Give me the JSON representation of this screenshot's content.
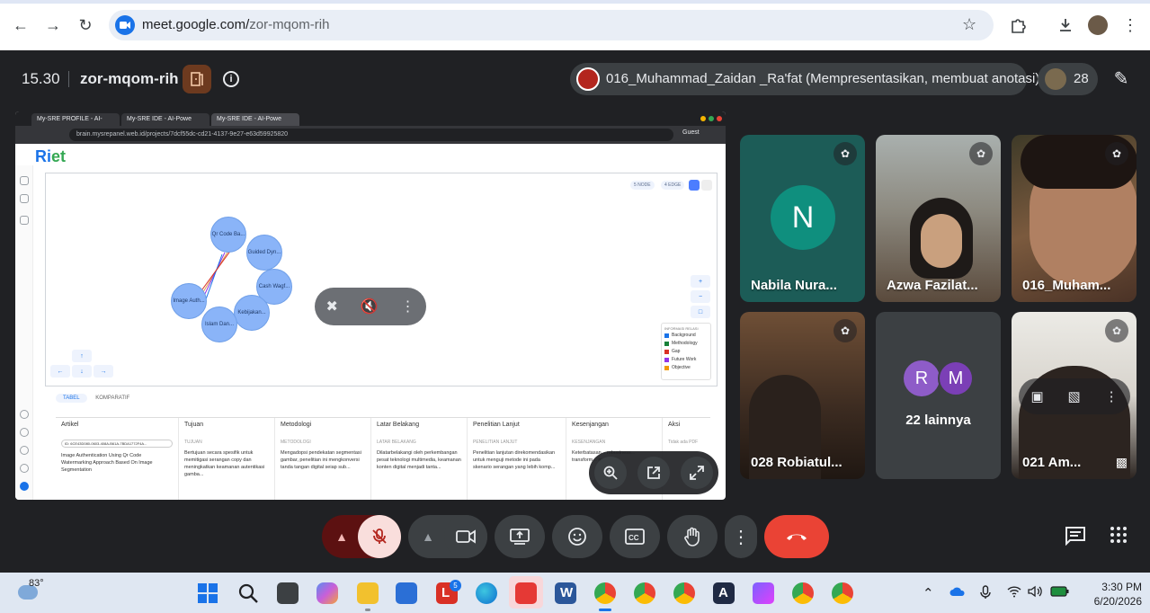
{
  "browser": {
    "url_host": "meet.google.com/",
    "url_path": "zor-mqom-rih"
  },
  "meet": {
    "time": "15.30",
    "meeting_code": "zor-mqom-rih",
    "presenter": "016_Muhammad_Zaidan _Ra'fat (Mempresentasikan, membuat anotasi)",
    "participant_count": "28"
  },
  "shared_screen": {
    "tabs": [
      "My-SRE PROFILE - AI-",
      "My-SRE IDE - AI-Powe",
      "My-SRE IDE - AI-Powe"
    ],
    "url": "brain.mysrepanel.web.id/projects/7dcf55dc-cd21-4137-9e27-e63d59925820",
    "guest_label": "Guest",
    "logo_a": "Ri",
    "logo_b": "et",
    "chip_nodes": "5 NODE",
    "chip_edges": "4 EDGE",
    "nodes": [
      "Qr Code Ba...",
      "Guided Dyn...",
      "Cash Wagf...",
      "Image Auth...",
      "Kebijakan...",
      "Islam Dan..."
    ],
    "legend_title": "INFORMASI RELASI",
    "legend": [
      {
        "label": "Background",
        "color": "#1a73e8"
      },
      {
        "label": "Methodology",
        "color": "#188038"
      },
      {
        "label": "Gap",
        "color": "#d93025"
      },
      {
        "label": "Future Work",
        "color": "#9334e6"
      },
      {
        "label": "Objective",
        "color": "#f29900"
      }
    ],
    "bottom_tabs": [
      "TABEL",
      "KOMPARATIF"
    ],
    "columns": [
      {
        "header": "Artikel",
        "tag": "ID: 6CE43D080-0603-408A-B61A-7BDA1772F4A...",
        "body": "Image Authentication Using Qr Code Watermarking Approach Based On Image Segmentation"
      },
      {
        "header": "Tujuan",
        "tag": "TUJUAN",
        "body": "Bertujuan secara spesifik untuk memitigasi serangan copy dan meningkatkan keamanan autentikasi gamba..."
      },
      {
        "header": "Metodologi",
        "tag": "METODOLOGI",
        "body": "Mengadopsi pendekatan segmentasi gambar, penelitian ini mengkonversi tanda tangan digital seiap sub..."
      },
      {
        "header": "Latar Belakang",
        "tag": "LATAR BELAKANG",
        "body": "Dilatarbelakangi oleh perkembangan pesat teknologi multimedia, keamanan konten digital menjadi tanta..."
      },
      {
        "header": "Penelitian Lanjut",
        "tag": "PENELITIAN LANJUT",
        "body": "Penelitian lanjutan direkomendasikan untuk menguji metode ini pada skenario serangan yang lebih komp..."
      },
      {
        "header": "Kesenjangan",
        "tag": "KESENJANGAN",
        "body": "Keterbatasan... robustness... transform... menu..."
      },
      {
        "header": "Aksi",
        "tag": "Tidak ada PDF",
        "body": ""
      }
    ]
  },
  "participants": [
    {
      "name": "Nabila Nura...",
      "initial": "N"
    },
    {
      "name": "Azwa Fazilat..."
    },
    {
      "name": "016_Muham..."
    },
    {
      "name": "028 Robiatul..."
    },
    {
      "name": "22 lainnya",
      "initials": [
        "R",
        "M"
      ]
    },
    {
      "name": "021 Am..."
    }
  ],
  "taskbar": {
    "temperature": "83°",
    "clock_time": "3:30 PM",
    "clock_date": "6/20/2026",
    "badge_l": "5"
  },
  "colors": {
    "meet_bg": "#202124",
    "end_call": "#ea4335",
    "mic_off_bg": "#f9dedc",
    "accent": "#1a73e8"
  }
}
